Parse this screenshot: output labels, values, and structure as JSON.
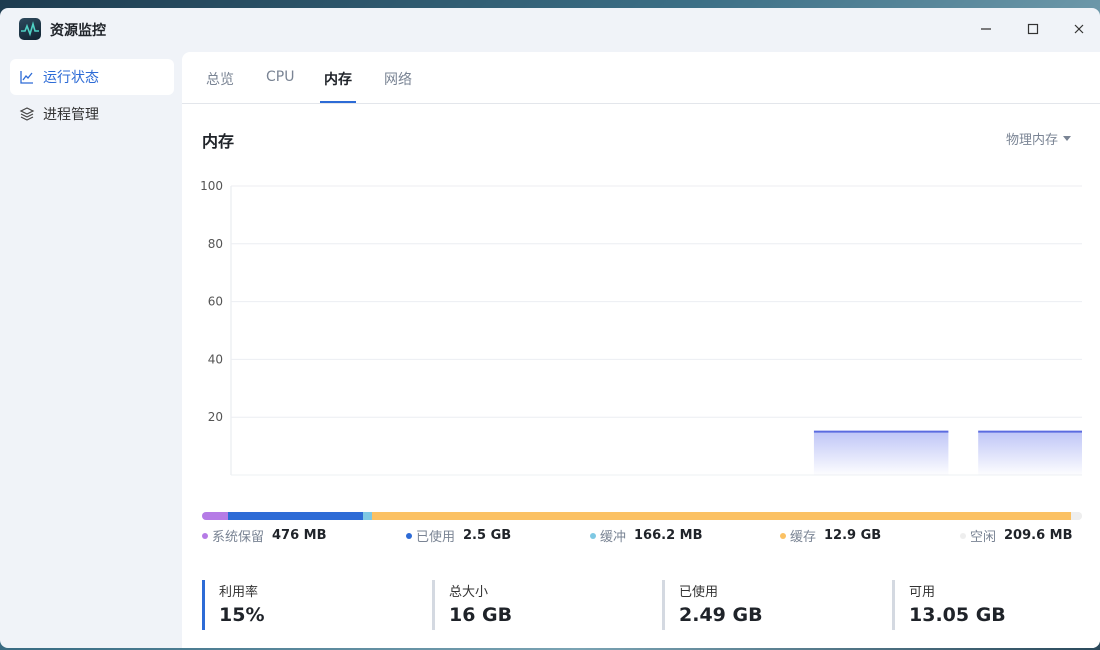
{
  "window": {
    "title": "资源监控"
  },
  "sidebar": {
    "items": [
      {
        "label": "运行状态",
        "icon": "line-chart-icon"
      },
      {
        "label": "进程管理",
        "icon": "layers-icon"
      }
    ]
  },
  "tabs": [
    {
      "label": "总览"
    },
    {
      "label": "CPU"
    },
    {
      "label": "内存"
    },
    {
      "label": "网络"
    }
  ],
  "section": {
    "title": "内存",
    "dropdown": "物理内存"
  },
  "chart_data": {
    "type": "area",
    "yticks": [
      100,
      80,
      60,
      40,
      20
    ],
    "ylim": [
      0,
      100
    ],
    "grid": true,
    "series": [
      {
        "segments": [
          {
            "x": [
              0.685,
              0.843
            ],
            "y": 15
          },
          {
            "x": [
              0.878,
              1.0
            ],
            "y": 15
          }
        ]
      }
    ],
    "color": "#5b6be0"
  },
  "memory_bar": {
    "segments": [
      {
        "label": "系统保留",
        "value": "476 MB",
        "fraction": 0.029,
        "color": "#b57be6"
      },
      {
        "label": "已使用",
        "value": "2.5 GB",
        "fraction": 0.154,
        "color": "#2d6bd6"
      },
      {
        "label": "缓冲",
        "value": "166.2 MB",
        "fraction": 0.01,
        "color": "#7ec8e3"
      },
      {
        "label": "缓存",
        "value": "12.9 GB",
        "fraction": 0.795,
        "color": "#fbc163"
      },
      {
        "label": "空闲",
        "value": "209.6 MB",
        "fraction": 0.012,
        "color": "#eeeeee"
      }
    ]
  },
  "stats": [
    {
      "label": "利用率",
      "value": "15%"
    },
    {
      "label": "总大小",
      "value": "16 GB"
    },
    {
      "label": "已使用",
      "value": "2.49 GB"
    },
    {
      "label": "可用",
      "value": "13.05 GB"
    }
  ]
}
